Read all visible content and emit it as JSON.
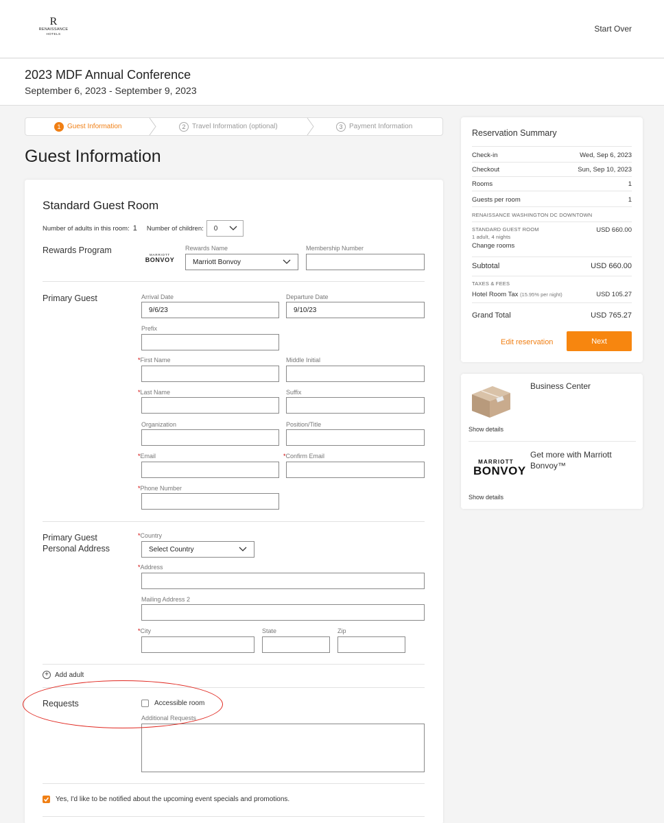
{
  "header": {
    "logo": {
      "letter": "R",
      "name": "RENAISSANCE",
      "sub": "HOTELS"
    },
    "start_over": "Start Over"
  },
  "event": {
    "title": "2023 MDF Annual Conference",
    "dates": "September 6, 2023 - September 9, 2023"
  },
  "steps": [
    {
      "num": "1",
      "label": "Guest Information",
      "active": true
    },
    {
      "num": "2",
      "label": "Travel Information (optional)",
      "active": false
    },
    {
      "num": "3",
      "label": "Payment Information",
      "active": false
    }
  ],
  "page_heading": "Guest Information",
  "room": {
    "title": "Standard Guest Room",
    "adults_label": "Number of adults in this room:",
    "adults_value": "1",
    "children_label": "Number of children:",
    "children_value": "0"
  },
  "rewards": {
    "section_label": "Rewards Program",
    "logo_small": "MARRIOTT",
    "logo_big": "BONVOY",
    "name_label": "Rewards Name",
    "name_value": "Marriott Bonvoy",
    "membership_label": "Membership Number",
    "membership_value": ""
  },
  "primary_guest": {
    "section_label": "Primary Guest",
    "arrival_label": "Arrival Date",
    "arrival_value": "9/6/23",
    "departure_label": "Departure Date",
    "departure_value": "9/10/23",
    "prefix_label": "Prefix",
    "first_name_label": "First Name",
    "middle_initial_label": "Middle Initial",
    "last_name_label": "Last Name",
    "suffix_label": "Suffix",
    "organization_label": "Organization",
    "position_label": "Position/Title",
    "email_label": "Email",
    "confirm_email_label": "Confirm Email",
    "phone_label": "Phone Number",
    "required_mark": "*"
  },
  "address": {
    "section_label_1": "Primary Guest",
    "section_label_2": "Personal Address",
    "country_label": "Country",
    "country_value": "Select Country",
    "address_label": "Address",
    "mailing2_label": "Mailing Address 2",
    "city_label": "City",
    "state_label": "State",
    "zip_label": "Zip"
  },
  "add_adult": "Add adult",
  "requests": {
    "section_label": "Requests",
    "accessible_label": "Accessible room",
    "accessible_checked": false,
    "additional_label": "Additional Requests"
  },
  "notify": {
    "label": "Yes, I'd like to be notified about the upcoming event specials and promotions.",
    "checked": true
  },
  "summary": {
    "title": "Reservation Summary",
    "checkin_label": "Check-in",
    "checkin_value": "Wed, Sep 6, 2023",
    "checkout_label": "Checkout",
    "checkout_value": "Sun, Sep 10, 2023",
    "rooms_label": "Rooms",
    "rooms_value": "1",
    "guests_label": "Guests per room",
    "guests_value": "1",
    "hotel_name": "RENAISSANCE WASHINGTON DC DOWNTOWN",
    "room_type": "STANDARD GUEST ROOM",
    "room_price": "USD 660.00",
    "room_detail": "1 adult, 4 nights",
    "change_rooms": "Change rooms",
    "subtotal_label": "Subtotal",
    "subtotal_value": "USD 660.00",
    "taxes_label": "TAXES & FEES",
    "tax_label": "Hotel Room Tax",
    "tax_rate": "(15.95% per night)",
    "tax_value": "USD 105.27",
    "grand_total_label": "Grand Total",
    "grand_total_value": "USD 765.27",
    "edit_label": "Edit reservation",
    "next_label": "Next"
  },
  "promos": [
    {
      "title": "Business Center",
      "details": "Show details",
      "icon": "gift-box-icon"
    },
    {
      "title": "Get more with Marriott Bonvoy™",
      "details": "Show details",
      "logo_small": "MARRIOTT",
      "logo_big": "BONVOY"
    }
  ],
  "colors": {
    "accent": "#f07f14",
    "required": "#cc0000",
    "annotation": "#e0261e"
  }
}
